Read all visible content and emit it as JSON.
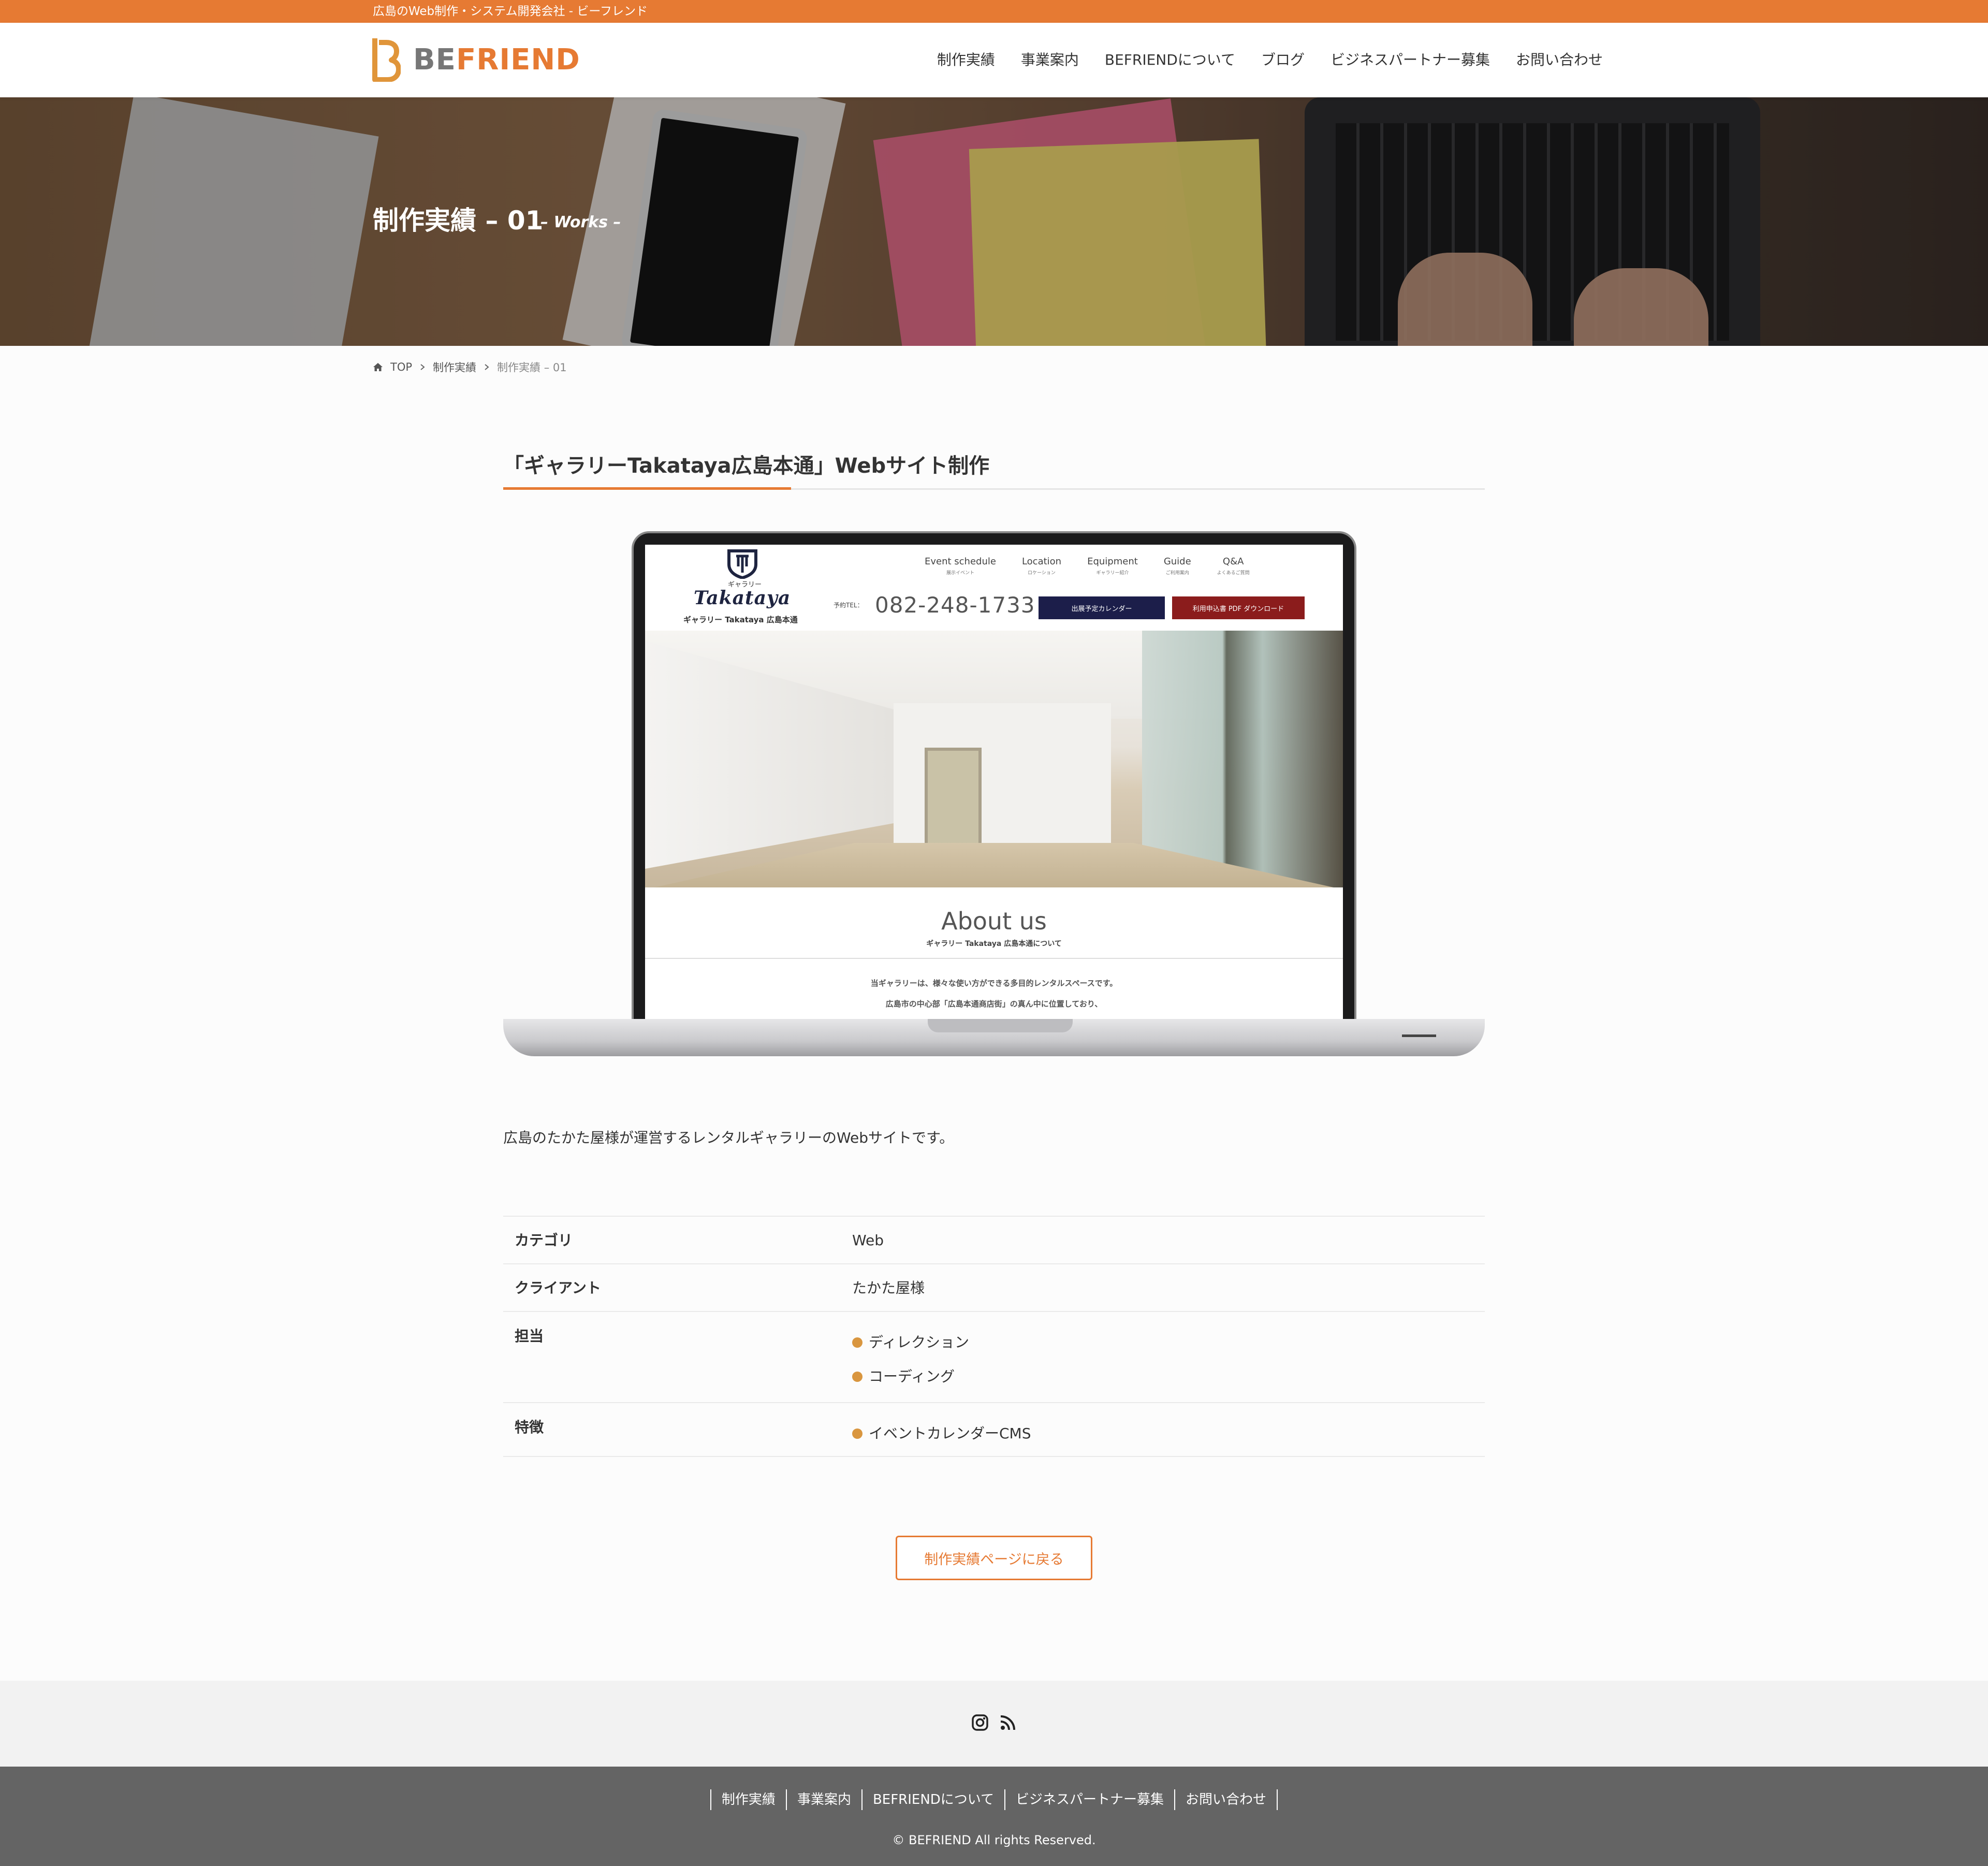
{
  "topbar": {
    "text": "広島のWeb制作・システム開発会社 - ビーフレンド"
  },
  "header": {
    "logo": {
      "be": "BE",
      "friend": "FRIEND"
    },
    "nav": [
      "制作実績",
      "事業案内",
      "BEFRIENDについて",
      "ブログ",
      "ビジネスパートナー募集",
      "お問い合わせ"
    ]
  },
  "hero": {
    "title": "制作実績 – 01",
    "subtitle": "– Works –"
  },
  "breadcrumb": {
    "home": "TOP",
    "parent": "制作実績",
    "current": "制作実績 – 01"
  },
  "entry": {
    "title": "「ギャラリーTakataya広島本通」Webサイト制作"
  },
  "mockup_site": {
    "gallery_small": "ギャラリー",
    "logo_script": "Takataya",
    "name": "ギャラリー Takataya 広島本通",
    "nav": [
      {
        "en": "Event schedule",
        "ja": "展示イベント"
      },
      {
        "en": "Location",
        "ja": "ロケーション"
      },
      {
        "en": "Equipment",
        "ja": "ギャラリー紹介"
      },
      {
        "en": "Guide",
        "ja": "ご利用案内"
      },
      {
        "en": "Q&A",
        "ja": "よくあるご質問"
      }
    ],
    "tel_label": "予約TEL：",
    "tel": "082-248-1733",
    "btn_calendar": "出展予定カレンダー",
    "btn_pdf": "利用申込書 PDF ダウンロード",
    "about": "About us",
    "about_ja": "ギャラリー Takataya 広島本通について",
    "para1": "当ギャラリーは、様々な使い方ができる多目的レンタルスペースです。",
    "para2": "広島市の中心部「広島本通商店街」の真ん中に位置しており、"
  },
  "description": "広島のたかた屋様が運営するレンタルギャラリーのWebサイトです。",
  "specs": {
    "category": {
      "label": "カテゴリ",
      "value": "Web"
    },
    "client": {
      "label": "クライアント",
      "value": "たかた屋様"
    },
    "role": {
      "label": "担当",
      "items": [
        "ディレクション",
        "コーディング"
      ]
    },
    "feature": {
      "label": "特徴",
      "items": [
        "イベントカレンダーCMS"
      ]
    }
  },
  "back_button": "制作実績ページに戻る",
  "social": {
    "icons": [
      "instagram-icon",
      "rss-icon"
    ]
  },
  "footer": {
    "nav": [
      "制作実績",
      "事業案内",
      "BEFRIENDについて",
      "ビジネスパートナー募集",
      "お問い合わせ"
    ],
    "copyright": "© BEFRIEND All rights Reserved."
  },
  "colors": {
    "accent": "#e67a33",
    "bullet": "#d9963f",
    "footer": "#646464"
  }
}
